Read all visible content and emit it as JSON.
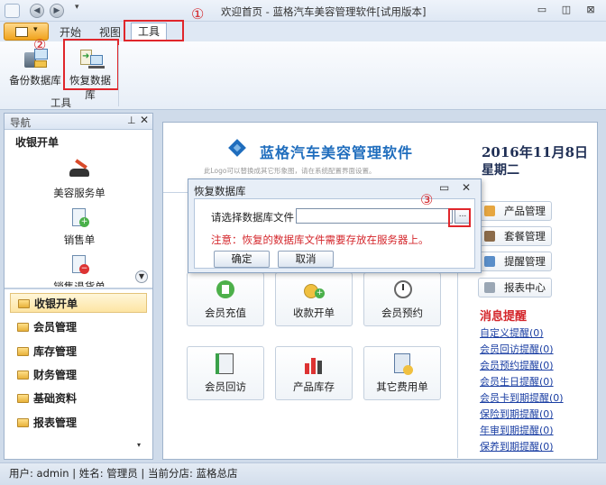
{
  "window": {
    "title": "欢迎首页 - 蓝格汽车美容管理软件[试用版本]"
  },
  "quick_access": {
    "dropdown_glyph": "▾"
  },
  "tabs": {
    "start": "开始",
    "view": "视图",
    "tools": "工具"
  },
  "ribbon": {
    "backup_label": "备份数据库",
    "restore_label": "恢复数据库",
    "group_label": "工具"
  },
  "annotations": {
    "one": "①",
    "two": "②",
    "three": "③"
  },
  "nav": {
    "title": "导航",
    "section": "收银开单",
    "items": [
      {
        "label": "美容服务单"
      },
      {
        "label": "销售单"
      },
      {
        "label": "销售退货单"
      }
    ],
    "categories": [
      "收银开单",
      "会员管理",
      "库存管理",
      "财务管理",
      "基础资料",
      "报表管理"
    ]
  },
  "main": {
    "logo_text": "蓝格汽车美容管理软件",
    "logo_subtext": "此Logo可以替换成其它形象图，请在系统配置界面设置。",
    "date": "2016年11月8日",
    "weekday": "星期二",
    "quick_buttons": [
      "会员充值",
      "收款开单",
      "会员预约",
      "会员回访",
      "产品库存",
      "其它费用单"
    ],
    "side_buttons": [
      "产品管理",
      "套餐管理",
      "提醒管理",
      "报表中心"
    ],
    "messages_title": "消息提醒",
    "messages": [
      "自定义提醒(0)",
      "会员回访提醒(0)",
      "会员预约提醒(0)",
      "会员生日提醒(0)",
      "会员卡到期提醒(0)",
      "保险到期提醒(0)",
      "年审到期提醒(0)",
      "保养到期提醒(0)"
    ]
  },
  "dialog": {
    "title": "恢复数据库",
    "label": "请选择数据库文件：",
    "input_value": "",
    "browse_label": "...",
    "note": "注意：恢复的数据库文件需要存放在服务器上。",
    "ok_label": "确定",
    "cancel_label": "取消"
  },
  "statusbar": {
    "text": "用户: admin  |  姓名: 管理员  |  当前分店: 蓝格总店"
  },
  "colors": {
    "accent": "#1f6dbd",
    "alert": "#d4262b",
    "annotation": "#e0262b"
  }
}
